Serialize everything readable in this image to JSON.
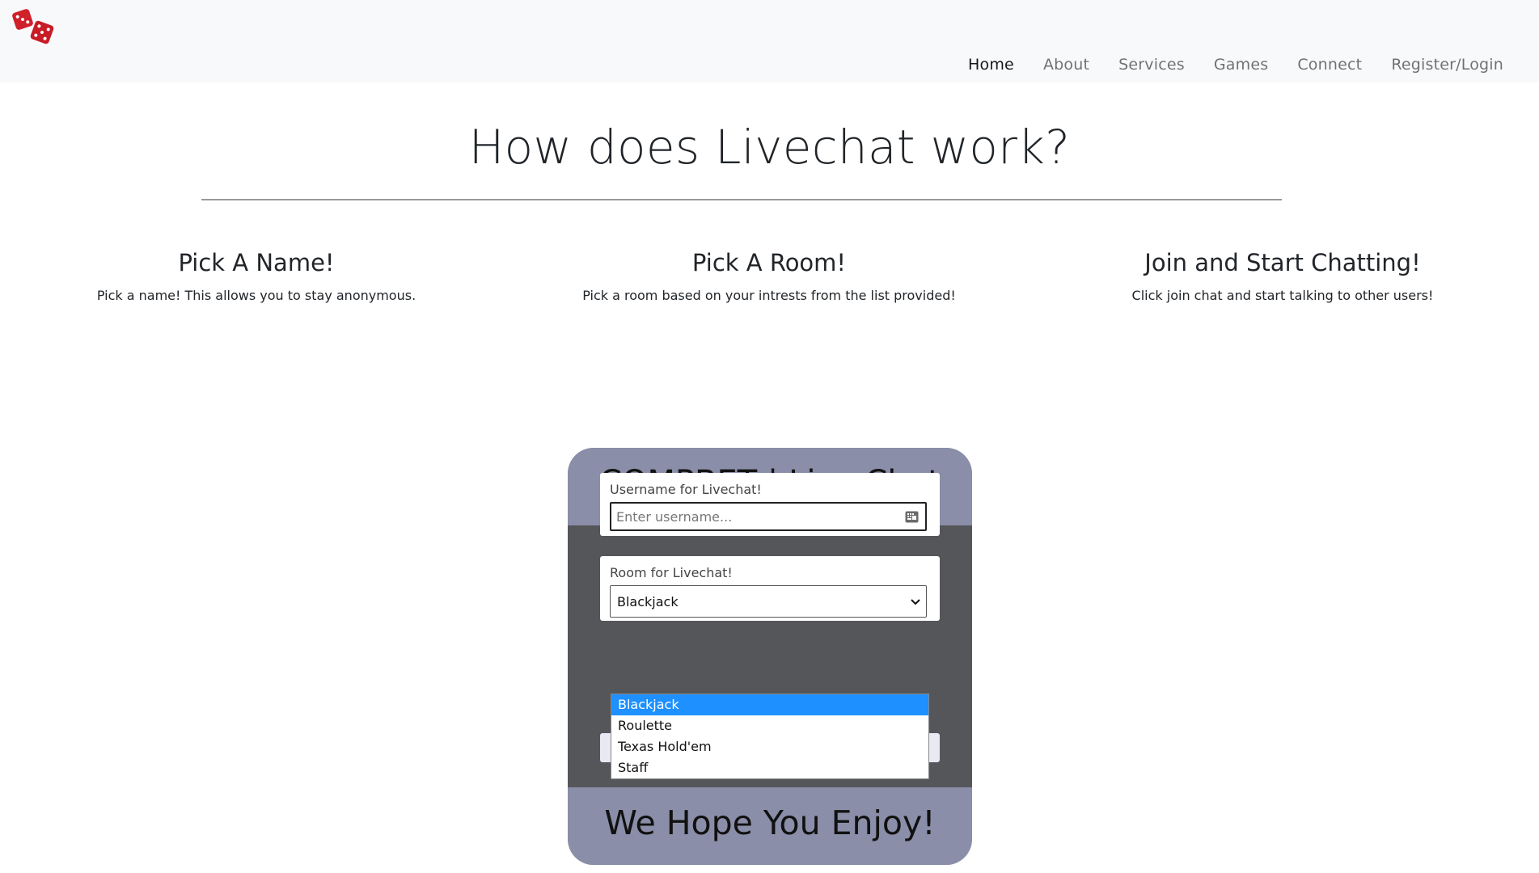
{
  "nav": {
    "items": [
      {
        "label": "Home",
        "active": true
      },
      {
        "label": "About",
        "active": false
      },
      {
        "label": "Services",
        "active": false
      },
      {
        "label": "Games",
        "active": false
      },
      {
        "label": "Connect",
        "active": false
      },
      {
        "label": "Register/Login",
        "active": false
      }
    ]
  },
  "hero": {
    "title": "How does Livechat work?"
  },
  "steps": [
    {
      "title": "Pick A Name!",
      "text": "Pick a name! This allows you to stay anonymous."
    },
    {
      "title": "Pick A Room!",
      "text": "Pick a room based on your intrests from the list provided!"
    },
    {
      "title": "Join and Start Chatting!",
      "text": "Click join chat and start talking to other users!"
    }
  ],
  "chat": {
    "header": "COMPBET | Live Chat",
    "username_label": "Username for Livechat!",
    "username_placeholder": "Enter username...",
    "room_label": "Room for Livechat!",
    "room_selected": "Blackjack",
    "room_options": [
      "Blackjack",
      "Roulette",
      "Texas Hold'em",
      "Staff"
    ],
    "footer": "We Hope You Enjoy!"
  },
  "colors": {
    "card_header": "#8a8ea8",
    "card_body": "#55565a",
    "dropdown_highlight": "#1e90ff",
    "dice": "#d0202a"
  },
  "icons": {
    "logo": "dice-icon",
    "input_helper": "keyboard-icon",
    "select_arrow": "chevron-down-icon"
  }
}
